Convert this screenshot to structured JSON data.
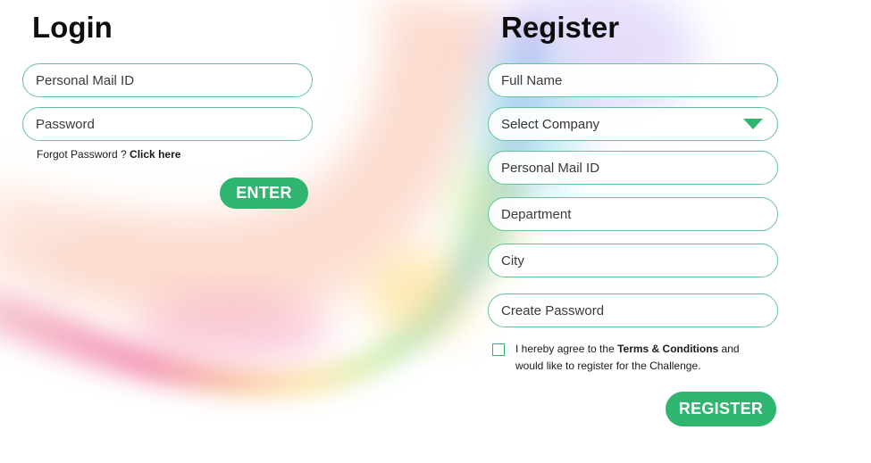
{
  "login": {
    "title": "Login",
    "email_placeholder": "Personal Mail ID",
    "password_placeholder": "Password",
    "forgot_text": "Forgot Password ? ",
    "forgot_link": "Click here",
    "enter_label": "ENTER"
  },
  "register": {
    "title": "Register",
    "full_name_placeholder": "Full Name",
    "company_select": "Select Company",
    "email_placeholder": "Personal Mail ID",
    "department_placeholder": "Department",
    "city_placeholder": "City",
    "password_placeholder": "Create Password",
    "terms_prefix": "I hereby agree to the ",
    "terms_link": "Terms & Conditions",
    "terms_suffix": " and would like to register for the Challenge.",
    "terms_checked": false,
    "register_label": "REGISTER"
  },
  "colors": {
    "accent": "#2fb56f",
    "field_border": "#63c49a",
    "heading": "#0e0e0e"
  },
  "icons": {
    "company_dropdown": "triangle-down-icon",
    "terms_checkbox": "checkbox-icon"
  }
}
